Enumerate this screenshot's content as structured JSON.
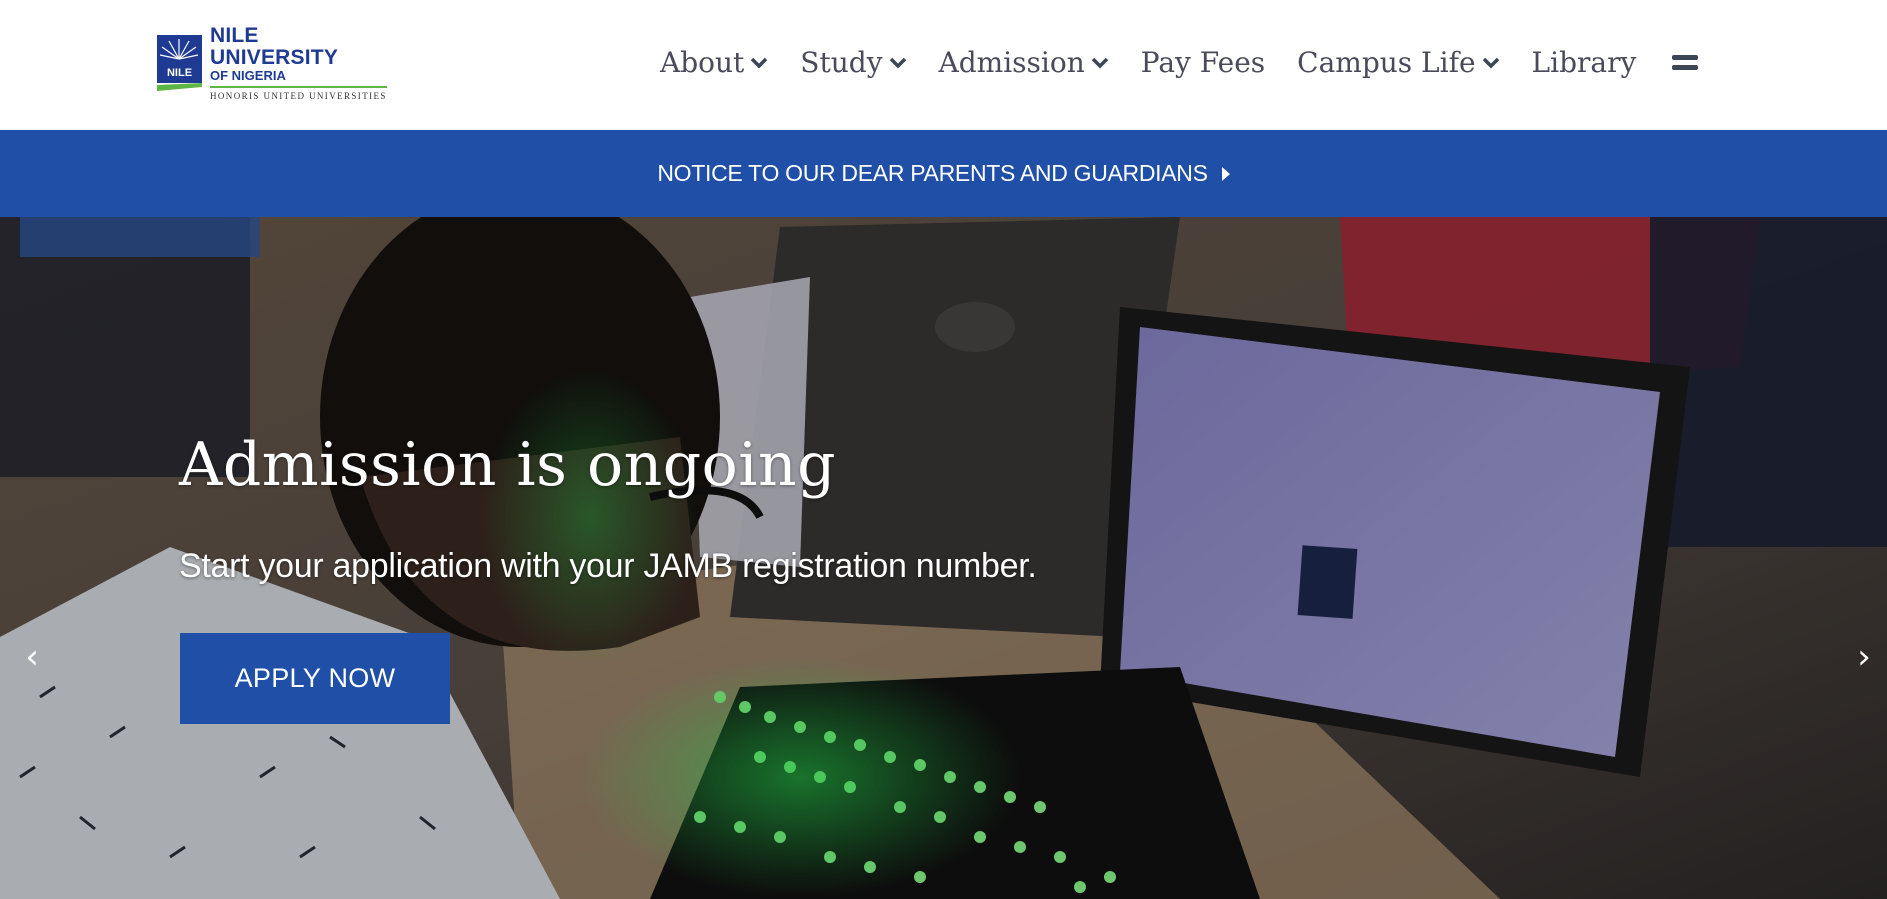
{
  "logo": {
    "line1": "NILE UNIVERSITY",
    "line2": "OF NIGERIA",
    "line3": "HONORIS UNITED UNIVERSITIES",
    "mark_text": "NILE"
  },
  "nav": {
    "items": [
      {
        "label": "About",
        "has_dropdown": true
      },
      {
        "label": "Study",
        "has_dropdown": true
      },
      {
        "label": "Admission",
        "has_dropdown": true
      },
      {
        "label": "Pay Fees",
        "has_dropdown": false
      },
      {
        "label": "Campus Life",
        "has_dropdown": true
      },
      {
        "label": "Library",
        "has_dropdown": false
      }
    ],
    "menu_icon": "hamburger-icon"
  },
  "notice": {
    "text": "NOTICE TO OUR DEAR PARENTS AND GUARDIANS",
    "icon": "caret-right-icon"
  },
  "hero": {
    "title": "Admission is ongoing",
    "subtitle": "Start your application with your JAMB registration number.",
    "cta_label": "APPLY NOW",
    "prev_glyph": "‹",
    "next_glyph": "›"
  },
  "colors": {
    "brand_blue": "#1f4fa6",
    "logo_blue": "#1f3a93",
    "logo_green": "#5db545",
    "nav_text": "#4a4a5a"
  }
}
